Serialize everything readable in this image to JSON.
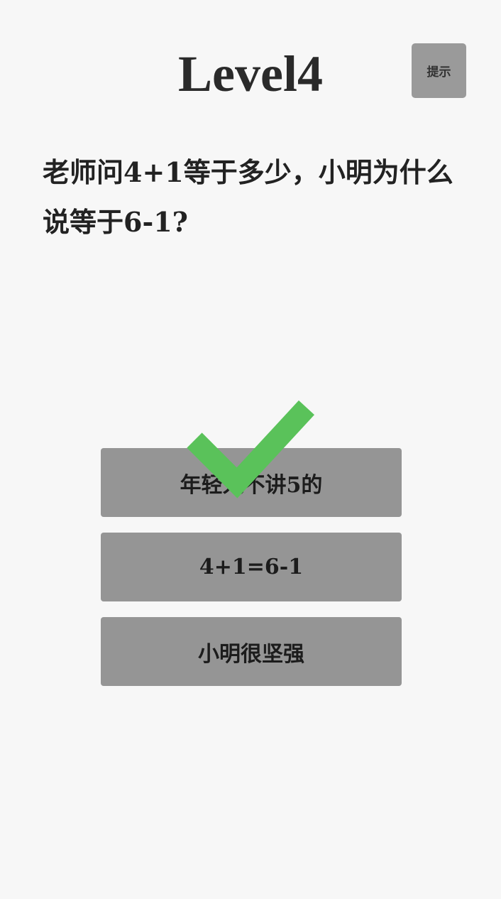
{
  "header": {
    "level_title": "Level4",
    "hint_label": "提示"
  },
  "question": {
    "text": "老师问4+1等于多少，小明为什么说等于6-1?"
  },
  "options": [
    {
      "label": "年轻人不讲5的"
    },
    {
      "label": "4+1=6-1"
    },
    {
      "label": "小明很坚强"
    }
  ],
  "feedback": {
    "icon": "checkmark-icon",
    "color": "#5ac25a"
  },
  "colors": {
    "background": "#f7f7f7",
    "button": "#959595",
    "hint_button": "#9a9a9a"
  }
}
